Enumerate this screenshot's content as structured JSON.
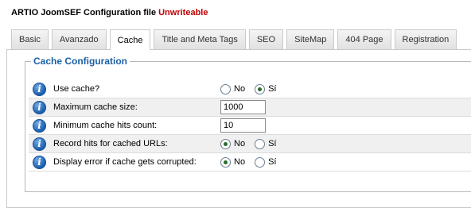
{
  "header": {
    "title": "ARTIO JoomSEF Configuration file",
    "status": "Unwriteable",
    "status_color": "#c00000"
  },
  "tabs": [
    {
      "label": "Basic",
      "active": false
    },
    {
      "label": "Avanzado",
      "active": false
    },
    {
      "label": "Cache",
      "active": true
    },
    {
      "label": "Title and Meta Tags",
      "active": false
    },
    {
      "label": "SEO",
      "active": false
    },
    {
      "label": "SiteMap",
      "active": false
    },
    {
      "label": "404 Page",
      "active": false
    },
    {
      "label": "Registration",
      "active": false
    }
  ],
  "section": {
    "legend": "Cache Configuration",
    "legend_color": "#1c5fa5"
  },
  "options": {
    "no": "No",
    "yes": "Sí"
  },
  "rows": [
    {
      "label": "Use cache?",
      "type": "radio",
      "selected": "yes"
    },
    {
      "label": "Maximum cache size:",
      "type": "text",
      "value": "1000"
    },
    {
      "label": "Minimum cache hits count:",
      "type": "text",
      "value": "10"
    },
    {
      "label": "Record hits for cached URLs:",
      "type": "radio",
      "selected": "no"
    },
    {
      "label": "Display error if cache gets corrupted:",
      "type": "radio",
      "selected": "no"
    }
  ],
  "icons": {
    "row_icon": "info-icon"
  }
}
